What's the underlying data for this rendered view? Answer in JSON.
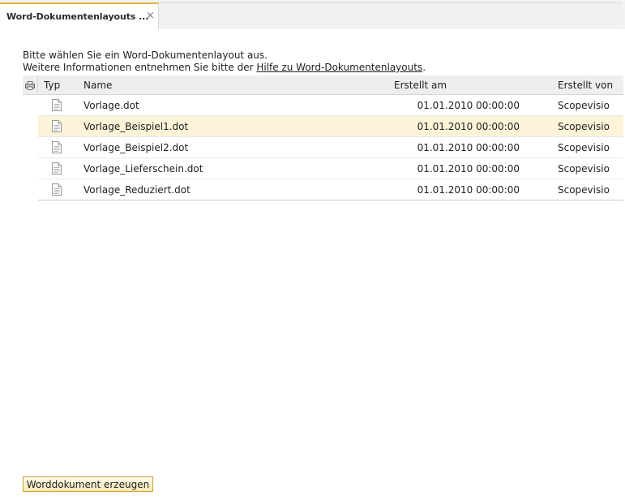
{
  "tab": {
    "title": "Word-Dokumentenlayouts ...",
    "close": "×"
  },
  "intro": {
    "line1": "Bitte wählen Sie ein Word-Dokumentenlayout aus.",
    "line2_prefix": "Weitere Informationen entnehmen Sie bitte der ",
    "line2_link": "Hilfe zu Word-Dokumentenlayouts",
    "line2_suffix": "."
  },
  "grid": {
    "columns": {
      "type": "Typ",
      "name": "Name",
      "created_at": "Erstellt am",
      "created_by": "Erstellt von"
    },
    "rows": [
      {
        "icon": "document-icon",
        "name": "Vorlage.dot",
        "created_at": "01.01.2010 00:00:00",
        "created_by": "Scopevisio",
        "selected": false
      },
      {
        "icon": "document-icon",
        "name": "Vorlage_Beispiel1.dot",
        "created_at": "01.01.2010 00:00:00",
        "created_by": "Scopevisio",
        "selected": true
      },
      {
        "icon": "document-icon",
        "name": "Vorlage_Beispiel2.dot",
        "created_at": "01.01.2010 00:00:00",
        "created_by": "Scopevisio",
        "selected": false
      },
      {
        "icon": "document-icon",
        "name": "Vorlage_Lieferschein.dot",
        "created_at": "01.01.2010 00:00:00",
        "created_by": "Scopevisio",
        "selected": false
      },
      {
        "icon": "document-icon",
        "name": "Vorlage_Reduziert.dot",
        "created_at": "01.01.2010 00:00:00",
        "created_by": "Scopevisio",
        "selected": false
      }
    ]
  },
  "actions": {
    "generate_label": "Worddokument erzeugen"
  },
  "colors": {
    "tab_accent": "#e0b640",
    "selection": "#fdf3d8",
    "button_border": "#c9a23a"
  }
}
